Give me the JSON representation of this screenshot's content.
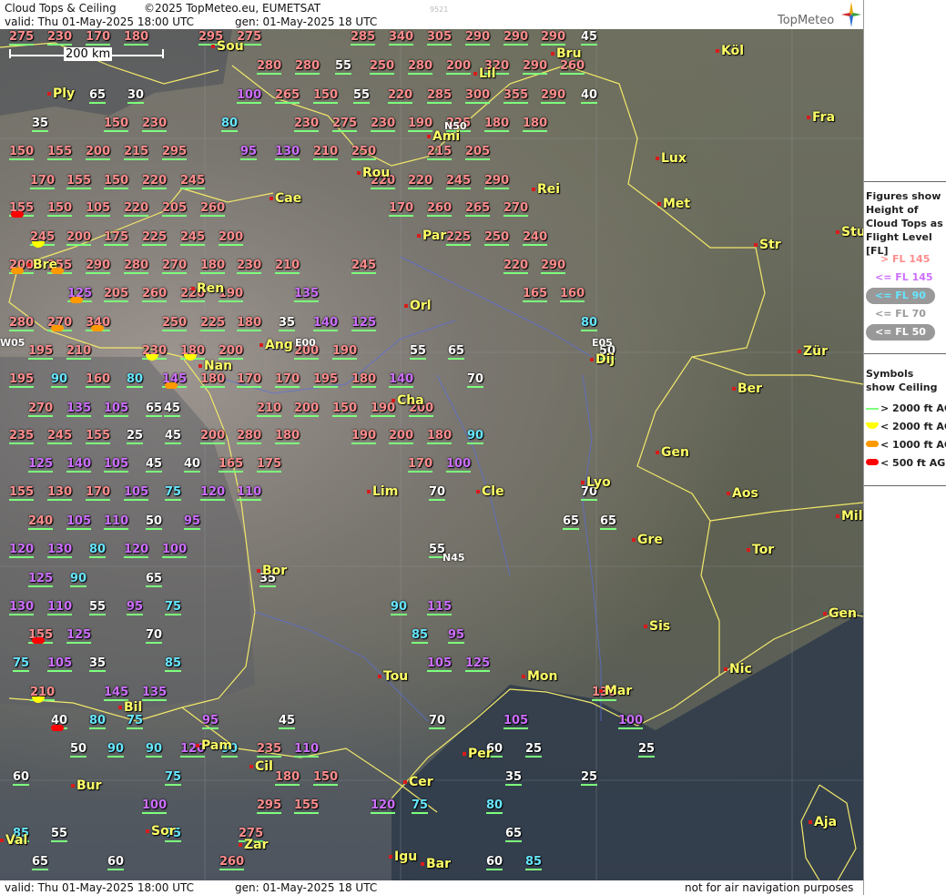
{
  "header": {
    "title": "Cloud Tops & Ceiling",
    "copyright": "©2025 TopMeteo.eu, EUMETSAT",
    "valid": "valid:  Thu  01-May-2025  18:00 UTC",
    "gen": "gen:  01-May-2025 18 UTC",
    "code": "9521",
    "logo": "TopMeteo"
  },
  "scale": "200 km",
  "footer": {
    "valid": "valid:  Thu  01-May-2025  18:00 UTC",
    "gen": "gen:  01-May-2025 18 UTC",
    "disclaimer": "not for air navigation purposes"
  },
  "legend": {
    "figures_title": "Figures show Height of Cloud Tops as Flight Level  [FL]",
    "fl_items": [
      "> FL 145",
      "<= FL 145",
      "<= FL 90",
      "<= FL 70",
      "<= FL 50"
    ],
    "symbols_title": "Symbols show Ceiling",
    "ceiling_items": [
      "> 2000 ft AGL",
      "< 2000 ft AGL",
      "< 1000 ft AGL",
      "< 500 ft AGL"
    ],
    "colors": {
      "pink": "#ff8c8c",
      "violet": "#cc6eff",
      "cyan": "#66e6ff",
      "grey": "#bdbdbd",
      "white": "#ffffff",
      "green": "#7dff7d",
      "yellow": "#ffff00",
      "orange": "#ff9900",
      "red": "#ff0000"
    }
  },
  "cities": [
    "Sou",
    "Ply",
    "Lil",
    "Bru",
    "Köl",
    "Fra",
    "Lux",
    "Ami",
    "Rou",
    "Cae",
    "Rei",
    "Met",
    "Str",
    "Stu",
    "Par",
    "Bre",
    "Ren",
    "Orl",
    "Ang",
    "Nan",
    "Dij",
    "Zür",
    "Ber",
    "Cha",
    "Gen",
    "Lim",
    "Cle",
    "Lyo",
    "Aos",
    "Mil",
    "Gre",
    "Tor",
    "Bor",
    "Sis",
    "Gen",
    "Nic",
    "Tou",
    "Mon",
    "Mar",
    "Bil",
    "Pam",
    "Cil",
    "Bur",
    "Per",
    "Cer",
    "Aja",
    "Sor",
    "Zar",
    "Val",
    "Igu",
    "Bar"
  ],
  "fixes": [
    "N50",
    "E00",
    "W05",
    "E05",
    "N45"
  ],
  "labels": [
    [
      "275",
      "pink"
    ],
    [
      "230",
      "pink"
    ],
    [
      "170",
      "pink"
    ],
    [
      "180",
      "pink"
    ],
    [
      "295",
      "pink"
    ],
    [
      "275",
      "pink"
    ],
    [
      "285",
      "pink"
    ],
    [
      "340",
      "pink"
    ],
    [
      "305",
      "pink"
    ],
    [
      "290",
      "pink"
    ],
    [
      "290",
      "pink"
    ],
    [
      "290",
      "pink"
    ],
    [
      "45",
      "white"
    ],
    [
      "280",
      "pink"
    ],
    [
      "280",
      "pink"
    ],
    [
      "55",
      "white"
    ],
    [
      "250",
      "pink"
    ],
    [
      "280",
      "pink"
    ],
    [
      "200",
      "pink"
    ],
    [
      "320",
      "pink"
    ],
    [
      "290",
      "pink"
    ],
    [
      "260",
      "pink"
    ],
    [
      "65",
      "white"
    ],
    [
      "30",
      "white"
    ],
    [
      "100",
      "violet"
    ],
    [
      "265",
      "pink"
    ],
    [
      "150",
      "pink"
    ],
    [
      "55",
      "white"
    ],
    [
      "220",
      "pink"
    ],
    [
      "285",
      "pink"
    ],
    [
      "300",
      "pink"
    ],
    [
      "355",
      "pink"
    ],
    [
      "290",
      "pink"
    ],
    [
      "40",
      "white"
    ],
    [
      "35",
      "white"
    ],
    [
      "150",
      "pink"
    ],
    [
      "230",
      "pink"
    ],
    [
      "80",
      "cyan"
    ],
    [
      "230",
      "pink"
    ],
    [
      "275",
      "pink"
    ],
    [
      "230",
      "pink"
    ],
    [
      "190",
      "pink"
    ],
    [
      "225",
      "pink"
    ],
    [
      "180",
      "pink"
    ],
    [
      "180",
      "pink"
    ],
    [
      "150",
      "pink"
    ],
    [
      "155",
      "pink"
    ],
    [
      "200",
      "pink"
    ],
    [
      "215",
      "pink"
    ],
    [
      "295",
      "pink"
    ],
    [
      "95",
      "violet"
    ],
    [
      "130",
      "violet"
    ],
    [
      "210",
      "pink"
    ],
    [
      "250",
      "pink"
    ],
    [
      "215",
      "pink"
    ],
    [
      "205",
      "pink"
    ],
    [
      "170",
      "pink"
    ],
    [
      "155",
      "pink"
    ],
    [
      "150",
      "pink"
    ],
    [
      "220",
      "pink"
    ],
    [
      "245",
      "pink"
    ],
    [
      "220",
      "pink"
    ],
    [
      "220",
      "pink"
    ],
    [
      "245",
      "pink"
    ],
    [
      "290",
      "pink"
    ],
    [
      "155",
      "pink"
    ],
    [
      "150",
      "pink"
    ],
    [
      "105",
      "pink"
    ],
    [
      "220",
      "pink"
    ],
    [
      "205",
      "pink"
    ],
    [
      "260",
      "pink"
    ],
    [
      "170",
      "pink"
    ],
    [
      "260",
      "pink"
    ],
    [
      "265",
      "pink"
    ],
    [
      "270",
      "pink"
    ],
    [
      "245",
      "pink"
    ],
    [
      "200",
      "pink"
    ],
    [
      "175",
      "pink"
    ],
    [
      "225",
      "pink"
    ],
    [
      "245",
      "pink"
    ],
    [
      "200",
      "pink"
    ],
    [
      "225",
      "pink"
    ],
    [
      "250",
      "pink"
    ],
    [
      "240",
      "pink"
    ],
    [
      "200",
      "pink"
    ],
    [
      "255",
      "pink"
    ],
    [
      "290",
      "pink"
    ],
    [
      "280",
      "pink"
    ],
    [
      "270",
      "pink"
    ],
    [
      "180",
      "pink"
    ],
    [
      "230",
      "pink"
    ],
    [
      "210",
      "pink"
    ],
    [
      "245",
      "pink"
    ],
    [
      "220",
      "pink"
    ],
    [
      "290",
      "pink"
    ],
    [
      "125",
      "violet"
    ],
    [
      "205",
      "pink"
    ],
    [
      "260",
      "pink"
    ],
    [
      "220",
      "pink"
    ],
    [
      "190",
      "pink"
    ],
    [
      "135",
      "violet"
    ],
    [
      "165",
      "pink"
    ],
    [
      "160",
      "pink"
    ],
    [
      "280",
      "pink"
    ],
    [
      "270",
      "pink"
    ],
    [
      "340",
      "pink"
    ],
    [
      "250",
      "pink"
    ],
    [
      "225",
      "pink"
    ],
    [
      "180",
      "pink"
    ],
    [
      "35",
      "white"
    ],
    [
      "140",
      "violet"
    ],
    [
      "125",
      "violet"
    ],
    [
      "80",
      "cyan"
    ],
    [
      "195",
      "pink"
    ],
    [
      "210",
      "pink"
    ],
    [
      "230",
      "pink"
    ],
    [
      "180",
      "pink"
    ],
    [
      "200",
      "pink"
    ],
    [
      "200",
      "pink"
    ],
    [
      "190",
      "pink"
    ],
    [
      "55",
      "white"
    ],
    [
      "65",
      "white"
    ],
    [
      "50",
      "white"
    ],
    [
      "195",
      "pink"
    ],
    [
      "90",
      "cyan"
    ],
    [
      "160",
      "pink"
    ],
    [
      "80",
      "cyan"
    ],
    [
      "145",
      "violet"
    ],
    [
      "180",
      "pink"
    ],
    [
      "170",
      "pink"
    ],
    [
      "170",
      "pink"
    ],
    [
      "195",
      "pink"
    ],
    [
      "180",
      "pink"
    ],
    [
      "140",
      "violet"
    ],
    [
      "70",
      "white"
    ],
    [
      "270",
      "pink"
    ],
    [
      "135",
      "violet"
    ],
    [
      "105",
      "violet"
    ],
    [
      "65",
      "white"
    ],
    [
      "210",
      "pink"
    ],
    [
      "200",
      "pink"
    ],
    [
      "150",
      "pink"
    ],
    [
      "190",
      "pink"
    ],
    [
      "200",
      "pink"
    ],
    [
      "45",
      "white"
    ],
    [
      "235",
      "pink"
    ],
    [
      "245",
      "pink"
    ],
    [
      "155",
      "pink"
    ],
    [
      "25",
      "white"
    ],
    [
      "45",
      "white"
    ],
    [
      "200",
      "pink"
    ],
    [
      "280",
      "pink"
    ],
    [
      "180",
      "pink"
    ],
    [
      "190",
      "pink"
    ],
    [
      "200",
      "pink"
    ],
    [
      "180",
      "pink"
    ],
    [
      "90",
      "cyan"
    ],
    [
      "125",
      "violet"
    ],
    [
      "140",
      "violet"
    ],
    [
      "105",
      "violet"
    ],
    [
      "45",
      "white"
    ],
    [
      "40",
      "white"
    ],
    [
      "165",
      "pink"
    ],
    [
      "175",
      "pink"
    ],
    [
      "170",
      "pink"
    ],
    [
      "100",
      "violet"
    ],
    [
      "155",
      "pink"
    ],
    [
      "130",
      "pink"
    ],
    [
      "170",
      "pink"
    ],
    [
      "105",
      "violet"
    ],
    [
      "75",
      "cyan"
    ],
    [
      "120",
      "violet"
    ],
    [
      "110",
      "violet"
    ],
    [
      "70",
      "white"
    ],
    [
      "70",
      "white"
    ],
    [
      "240",
      "pink"
    ],
    [
      "105",
      "violet"
    ],
    [
      "110",
      "violet"
    ],
    [
      "50",
      "white"
    ],
    [
      "95",
      "violet"
    ],
    [
      "65",
      "white"
    ],
    [
      "65",
      "white"
    ],
    [
      "120",
      "violet"
    ],
    [
      "130",
      "violet"
    ],
    [
      "80",
      "cyan"
    ],
    [
      "120",
      "violet"
    ],
    [
      "100",
      "violet"
    ],
    [
      "55",
      "white"
    ],
    [
      "125",
      "violet"
    ],
    [
      "90",
      "cyan"
    ],
    [
      "65",
      "white"
    ],
    [
      "35",
      "white"
    ],
    [
      "130",
      "violet"
    ],
    [
      "110",
      "violet"
    ],
    [
      "55",
      "white"
    ],
    [
      "95",
      "violet"
    ],
    [
      "75",
      "cyan"
    ],
    [
      "90",
      "cyan"
    ],
    [
      "115",
      "violet"
    ],
    [
      "155",
      "pink"
    ],
    [
      "125",
      "violet"
    ],
    [
      "70",
      "white"
    ],
    [
      "85",
      "cyan"
    ],
    [
      "95",
      "violet"
    ],
    [
      "75",
      "cyan"
    ],
    [
      "105",
      "violet"
    ],
    [
      "35",
      "white"
    ],
    [
      "85",
      "cyan"
    ],
    [
      "105",
      "violet"
    ],
    [
      "125",
      "violet"
    ],
    [
      "210",
      "pink"
    ],
    [
      "145",
      "violet"
    ],
    [
      "135",
      "violet"
    ],
    [
      "130",
      "pink"
    ],
    [
      "40",
      "white"
    ],
    [
      "80",
      "cyan"
    ],
    [
      "75",
      "cyan"
    ],
    [
      "95",
      "violet"
    ],
    [
      "45",
      "white"
    ],
    [
      "70",
      "white"
    ],
    [
      "105",
      "violet"
    ],
    [
      "100",
      "violet"
    ],
    [
      "50",
      "white"
    ],
    [
      "90",
      "cyan"
    ],
    [
      "90",
      "cyan"
    ],
    [
      "120",
      "violet"
    ],
    [
      "90",
      "cyan"
    ],
    [
      "235",
      "pink"
    ],
    [
      "110",
      "violet"
    ],
    [
      "60",
      "white"
    ],
    [
      "25",
      "white"
    ],
    [
      "25",
      "white"
    ],
    [
      "60",
      "white"
    ],
    [
      "75",
      "cyan"
    ],
    [
      "180",
      "pink"
    ],
    [
      "150",
      "pink"
    ],
    [
      "35",
      "white"
    ],
    [
      "25",
      "white"
    ],
    [
      "100",
      "violet"
    ],
    [
      "295",
      "pink"
    ],
    [
      "155",
      "pink"
    ],
    [
      "120",
      "violet"
    ],
    [
      "75",
      "cyan"
    ],
    [
      "80",
      "cyan"
    ],
    [
      "85",
      "cyan"
    ],
    [
      "55",
      "white"
    ],
    [
      "75",
      "cyan"
    ],
    [
      "275",
      "pink"
    ],
    [
      "65",
      "white"
    ],
    [
      "65",
      "white"
    ],
    [
      "60",
      "white"
    ],
    [
      "260",
      "pink"
    ],
    [
      "60",
      "white"
    ],
    [
      "85",
      "cyan"
    ]
  ]
}
